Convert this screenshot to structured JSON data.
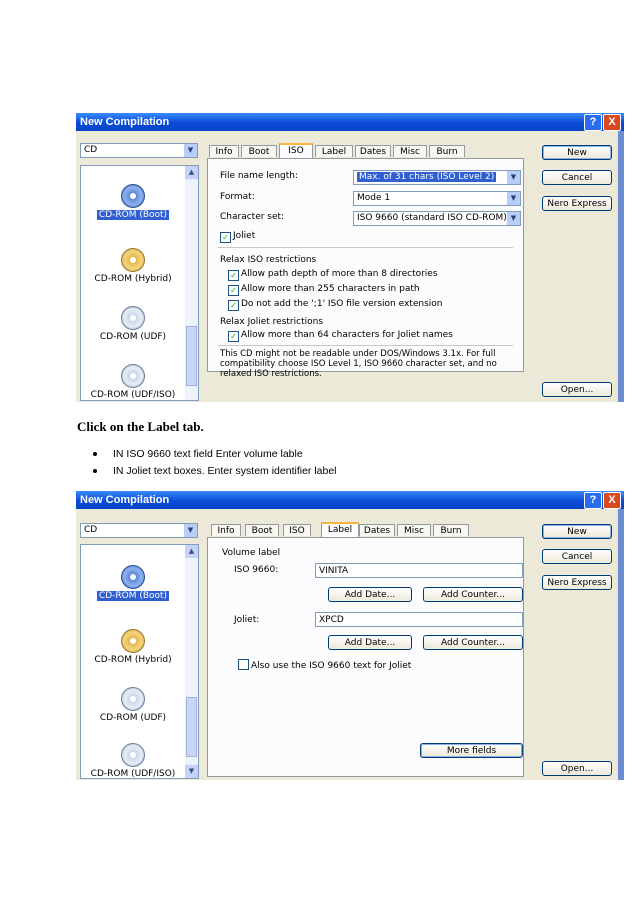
{
  "window": {
    "title": "New Compilation",
    "help": "?",
    "close": "X"
  },
  "media_select": "CD",
  "compilation_types": [
    {
      "label": "CD-ROM (Boot)",
      "selected": true
    },
    {
      "label": "CD-ROM (Hybrid)"
    },
    {
      "label": "CD-ROM (UDF)"
    },
    {
      "label": "CD-ROM (UDF/ISO)"
    }
  ],
  "tabs": [
    "Info",
    "Boot",
    "ISO",
    "Label",
    "Dates",
    "Misc",
    "Burn"
  ],
  "buttons": {
    "new": "New",
    "cancel": "Cancel",
    "nero_express": "Nero Express",
    "open": "Open..."
  },
  "iso_tab": {
    "file_name_length_label": "File name length:",
    "file_name_length_value": "Max. of 31 chars (ISO Level 2)",
    "format_label": "Format:",
    "format_value": "Mode 1",
    "charset_label": "Character set:",
    "charset_value": "ISO 9660 (standard ISO CD-ROM)",
    "joliet": "Joliet",
    "relax_iso_heading": "Relax ISO restrictions",
    "opt_depth": "Allow path depth of more than 8 directories",
    "opt_255": "Allow more than 255 characters in path",
    "opt_version": "Do not add the ';1' ISO file version extension",
    "relax_joliet_heading": "Relax Joliet restrictions",
    "opt_joliet64": "Allow more than 64 characters for Joliet names",
    "note": "This CD might not be readable under DOS/Windows 3.1x. For full compatibility choose ISO Level 1, ISO 9660 character set, and no relaxed ISO restrictions."
  },
  "instruction": {
    "heading": "Click on the Label tab.",
    "bullets": [
      "IN ISO 9660 text field Enter volume lable",
      "IN Joliet text boxes. Enter system identifier label"
    ]
  },
  "label_tab": {
    "volume_label": "Volume label",
    "iso_label": "ISO 9660:",
    "iso_value": "VINITA",
    "joliet_label": "Joliet:",
    "joliet_value": "XPCD",
    "add_date": "Add Date...",
    "add_counter": "Add Counter...",
    "also_use": "Also use the ISO 9660 text for Joliet",
    "more_fields": "More fields"
  },
  "colors": {
    "titlebar": "#0a4bd6",
    "dialog_bg": "#ece9d8",
    "selection": "#2f5fd0",
    "active_tab_accent": "#f9b63b"
  }
}
